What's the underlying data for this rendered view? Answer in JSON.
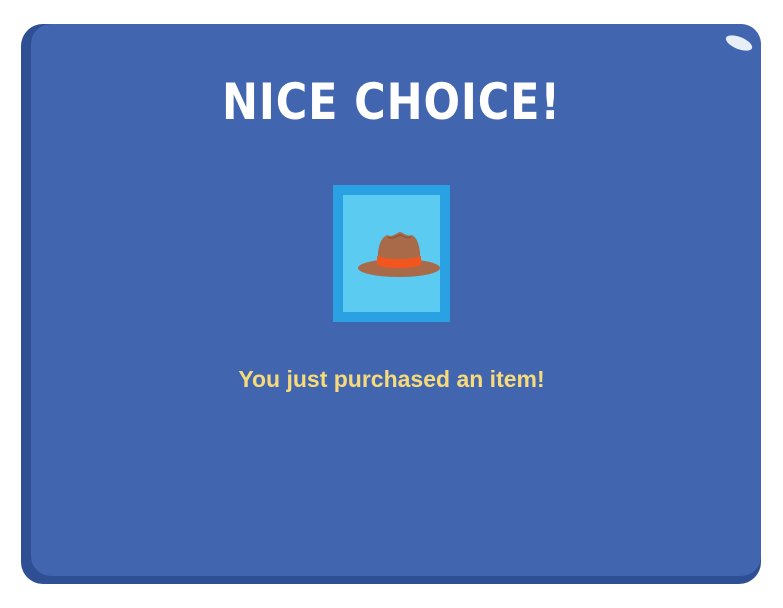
{
  "dialog": {
    "title": "NICE CHOICE!",
    "message": "You just purchased an item!",
    "item_icon": "fedora-hat-icon"
  },
  "colors": {
    "panel": "#4265b0",
    "panel_shadow": "#2f4f95",
    "title": "#ffffff",
    "message": "#f7db7a",
    "item_frame": "#2aa1e3",
    "item_background": "#5bcbf2",
    "hat": "#a86a48",
    "hat_band": "#f2551e"
  }
}
